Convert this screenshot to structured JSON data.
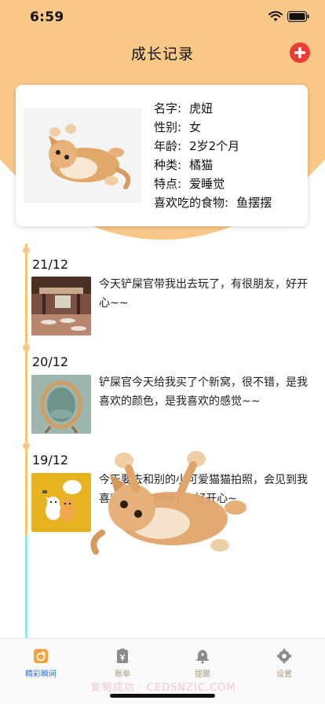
{
  "status_bar": {
    "time": "6:59"
  },
  "nav": {
    "title": "成长记录",
    "add_icon": "plus-circle-icon",
    "accent_color": "#ea3b34"
  },
  "header": {
    "background_color": "#f9c887"
  },
  "profile": {
    "photo": "kitten-photo",
    "rows": [
      {
        "label": "名字:",
        "value": "虎妞"
      },
      {
        "label": "性别:",
        "value": "女"
      },
      {
        "label": "年龄:",
        "value": "2岁2个月"
      },
      {
        "label": "种类:",
        "value": "橘猫"
      },
      {
        "label": "特点:",
        "value": "爱睡觉"
      },
      {
        "label": "喜欢吃的食物:",
        "value": "鱼摆摆"
      }
    ]
  },
  "timeline": {
    "entries": [
      {
        "date": "21/12",
        "text": "今天铲屎官带我出去玩了，有很朋友，好开心~~",
        "thumb": "restaurant-photo"
      },
      {
        "date": "20/12",
        "text": "铲屎官今天给我买了个新窝，很不错，是我喜欢的颜色，是我喜欢的感觉~~",
        "thumb": "cat-bed-photo"
      },
      {
        "date": "19/12",
        "text": "今天要去和别的小可爱猫猫拍照，会见到我喜欢的那位MM了，好开心~",
        "thumb": "cartoon-cats-photo"
      }
    ]
  },
  "tab_bar": {
    "tabs": [
      {
        "label": "精彩瞬间",
        "icon": "camera-badge-icon",
        "active": true
      },
      {
        "label": "账单",
        "icon": "bill-icon",
        "active": false
      },
      {
        "label": "提醒",
        "icon": "bell-icon",
        "active": false
      },
      {
        "label": "设置",
        "icon": "gear-icon",
        "active": false
      }
    ],
    "active_color": "#2c6fd6",
    "inactive_color": "#ad9b7c"
  },
  "watermark": {
    "text": "复制成功 · CEDSNZIC.COM"
  }
}
